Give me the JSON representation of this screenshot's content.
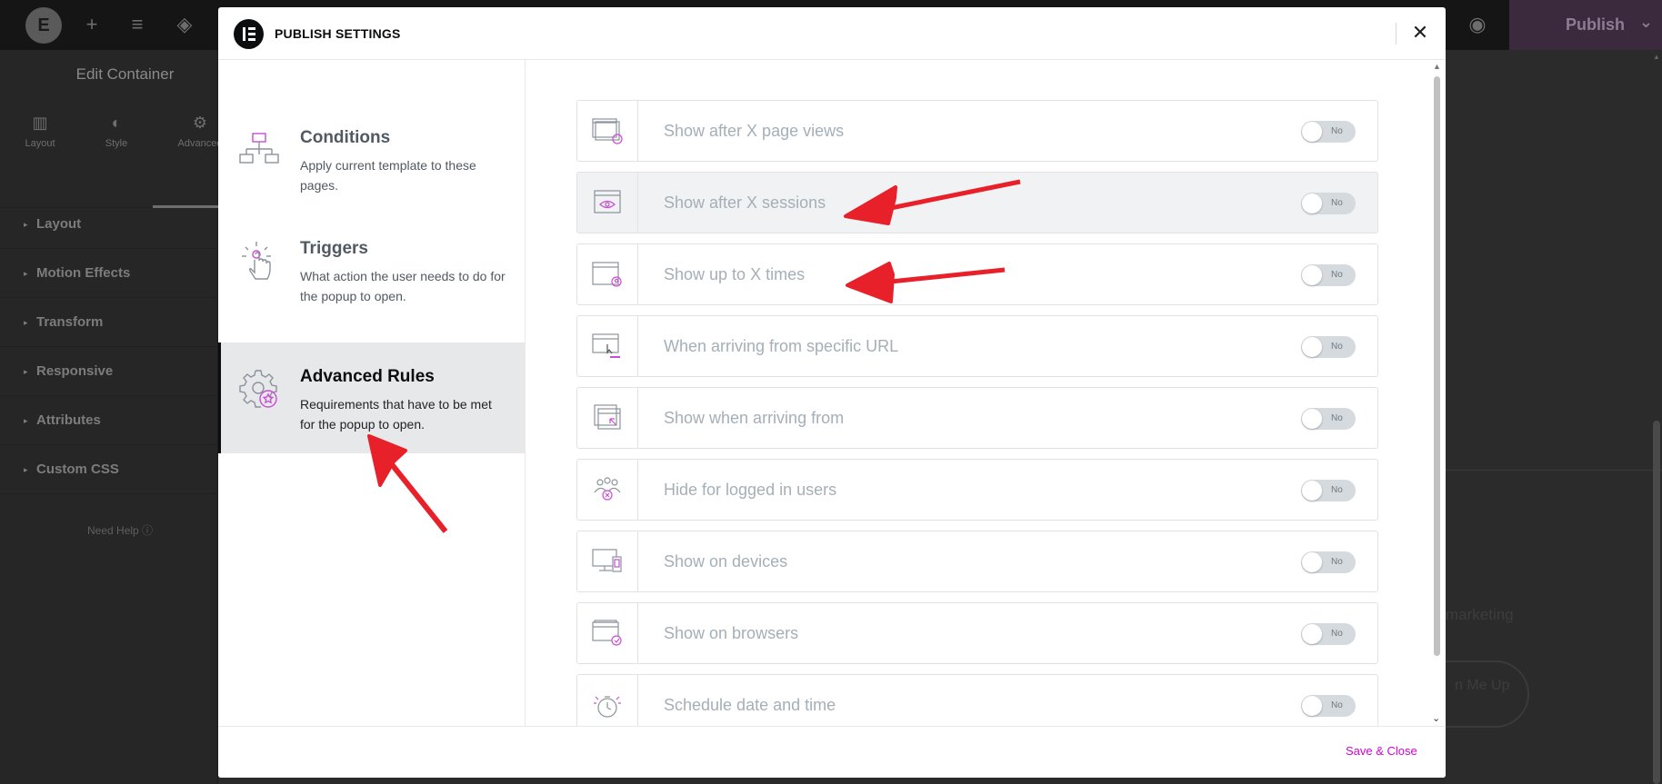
{
  "editor": {
    "sidebar_title": "Edit Container",
    "tabs": [
      {
        "label": "Layout",
        "icon": "layout-icon"
      },
      {
        "label": "Style",
        "icon": "style-icon"
      },
      {
        "label": "Advanced",
        "icon": "gear-icon"
      }
    ],
    "sections": [
      "Layout",
      "Motion Effects",
      "Transform",
      "Responsive",
      "Attributes",
      "Custom CSS"
    ],
    "need_help": "Need Help",
    "publish_label": "Publish",
    "canvas_ghost_text": "marketing",
    "canvas_ghost_button": "n Me Up"
  },
  "modal": {
    "title": "PUBLISH SETTINGS",
    "nav": [
      {
        "title": "Conditions",
        "description": "Apply current template to these pages.",
        "icon": "sitemap-icon"
      },
      {
        "title": "Triggers",
        "description": "What action the user needs to do for the popup to open.",
        "icon": "pointer-click-icon"
      },
      {
        "title": "Advanced Rules",
        "description": "Requirements that have to be met for the popup to open.",
        "icon": "gear-star-icon",
        "active": true
      }
    ],
    "rules": [
      {
        "label": "Show after X page views",
        "icon": "page-views-icon",
        "toggle": "No"
      },
      {
        "label": "Show after X sessions",
        "icon": "sessions-eye-icon",
        "toggle": "No"
      },
      {
        "label": "Show up to X times",
        "icon": "user-window-icon",
        "toggle": "No"
      },
      {
        "label": "When arriving from specific URL",
        "icon": "url-cursor-icon",
        "toggle": "No"
      },
      {
        "label": "Show when arriving from",
        "icon": "arriving-from-icon",
        "toggle": "No"
      },
      {
        "label": "Hide for logged in users",
        "icon": "users-hide-icon",
        "toggle": "No"
      },
      {
        "label": "Show on devices",
        "icon": "devices-icon",
        "toggle": "No"
      },
      {
        "label": "Show on browsers",
        "icon": "browser-check-icon",
        "toggle": "No"
      },
      {
        "label": "Schedule date and time",
        "icon": "stopwatch-icon",
        "toggle": "No"
      }
    ],
    "save_close": "Save & Close"
  },
  "colors": {
    "accent": "#d004d4",
    "annotation_arrow": "#e8202a",
    "active_nav_bg": "#e6e8ea"
  }
}
